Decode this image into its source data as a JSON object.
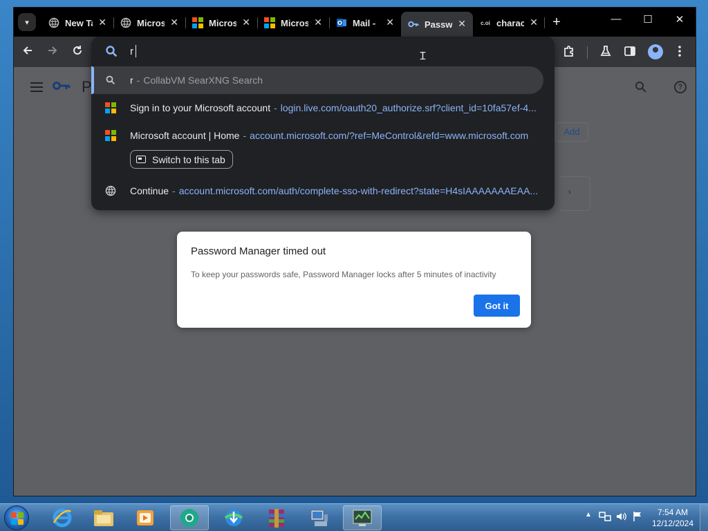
{
  "browser": {
    "tabs": [
      {
        "label": "New Tab",
        "icon": "globe-icon"
      },
      {
        "label": "Microsoft",
        "icon": "globe-icon"
      },
      {
        "label": "Microsoft",
        "icon": "microsoft-logo-icon"
      },
      {
        "label": "Microsoft",
        "icon": "microsoft-logo-icon"
      },
      {
        "label": "Mail -",
        "icon": "outlook-icon"
      },
      {
        "label": "Passwords",
        "icon": "key-icon",
        "active": true
      },
      {
        "label": "charact",
        "icon": "cdi-icon",
        "icon_text": "c.oi"
      }
    ],
    "new_tab_symbol": "+",
    "window_controls": {
      "minimize": "—",
      "maximize": "☐",
      "close": "✕"
    }
  },
  "omnibox": {
    "value": "r",
    "suggestions": [
      {
        "title": "r",
        "dash": "-",
        "subtitle": "CollabVM SearXNG Search",
        "icon": "search-icon",
        "selected": true
      },
      {
        "title": "Sign in to your Microsoft account",
        "dash": "-",
        "url": "login.live.com/oauth20_authorize.srf?client_id=10fa57ef-4...",
        "icon": "microsoft-logo-icon"
      },
      {
        "title": "Microsoft account | Home",
        "dash": "-",
        "url": "account.microsoft.com/?ref=MeControl&refd=www.microsoft.com",
        "icon": "microsoft-logo-icon",
        "action": "Switch to this tab"
      },
      {
        "title": "Continue",
        "dash": "-",
        "url": "account.microsoft.com/auth/complete-sso-with-redirect?state=H4sIAAAAAAAEAA...",
        "icon": "globe-icon"
      }
    ]
  },
  "page": {
    "title_letter": "P",
    "add_button": "Add",
    "card_chevron": "›"
  },
  "dialog": {
    "title": "Password Manager timed out",
    "body": "To keep your passwords safe, Password Manager locks after 5 minutes of inactivity",
    "button": "Got it"
  },
  "taskbar": {
    "apps": [
      "internet-explorer-icon",
      "file-explorer-icon",
      "media-player-icon",
      "chrome-canary-icon",
      "download-manager-icon",
      "winrar-icon",
      "network-computer-icon",
      "system-monitor-icon"
    ],
    "clock_time": "7:54 AM",
    "clock_date": "12/12/2024"
  },
  "colors": {
    "accent": "#8ab4f8",
    "dialog_button": "#1a73e8",
    "ms_red": "#f25022",
    "ms_green": "#7fba00",
    "ms_blue": "#00a4ef",
    "ms_yellow": "#ffb900"
  }
}
